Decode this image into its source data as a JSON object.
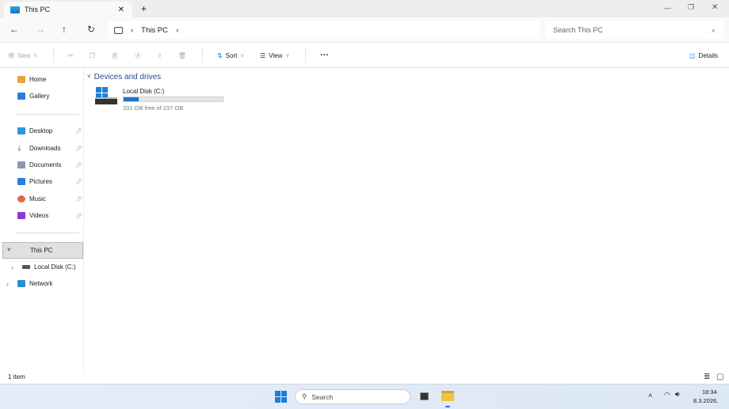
{
  "tab": {
    "title": "This PC",
    "close": "✕",
    "new_tab": "+"
  },
  "window": {
    "minimize": "—",
    "restore": "❐",
    "close": "✕"
  },
  "address": {
    "back": "←",
    "forward": "→",
    "up": "↑",
    "refresh": "↻",
    "crumbs": [
      "This PC"
    ],
    "sep": "›",
    "search_placeholder": "Search This PC"
  },
  "toolbar": {
    "new": "New",
    "sort": "Sort",
    "view": "View",
    "more": "···",
    "details": "Details"
  },
  "sidebar": {
    "quick": [
      {
        "label": "Home",
        "color": "#e8a33a"
      },
      {
        "label": "Gallery",
        "color": "#2b7fd8"
      }
    ],
    "pinned": [
      {
        "label": "Desktop",
        "color": "#2a9ae0"
      },
      {
        "label": "Downloads",
        "color": "#1f9e6a"
      },
      {
        "label": "Documents",
        "color": "#8a9ab0"
      },
      {
        "label": "Pictures",
        "color": "#2b7fd8"
      },
      {
        "label": "Music",
        "color": "#e06a4a"
      },
      {
        "label": "Videos",
        "color": "#8a3ad0"
      }
    ],
    "this_pc": "This PC",
    "local_disk": "Local Disk (C:)",
    "network": "Network"
  },
  "content": {
    "group": "Devices and drives",
    "drive": {
      "name": "Local Disk (C:)",
      "free_text": "201 GB free of 237 GB",
      "used_percent": 15.2,
      "bar_color": "#1a73d0"
    }
  },
  "status": {
    "items": "1 item"
  },
  "taskbar": {
    "search": "Search",
    "time": "18:34",
    "date": "8.3.2026."
  }
}
